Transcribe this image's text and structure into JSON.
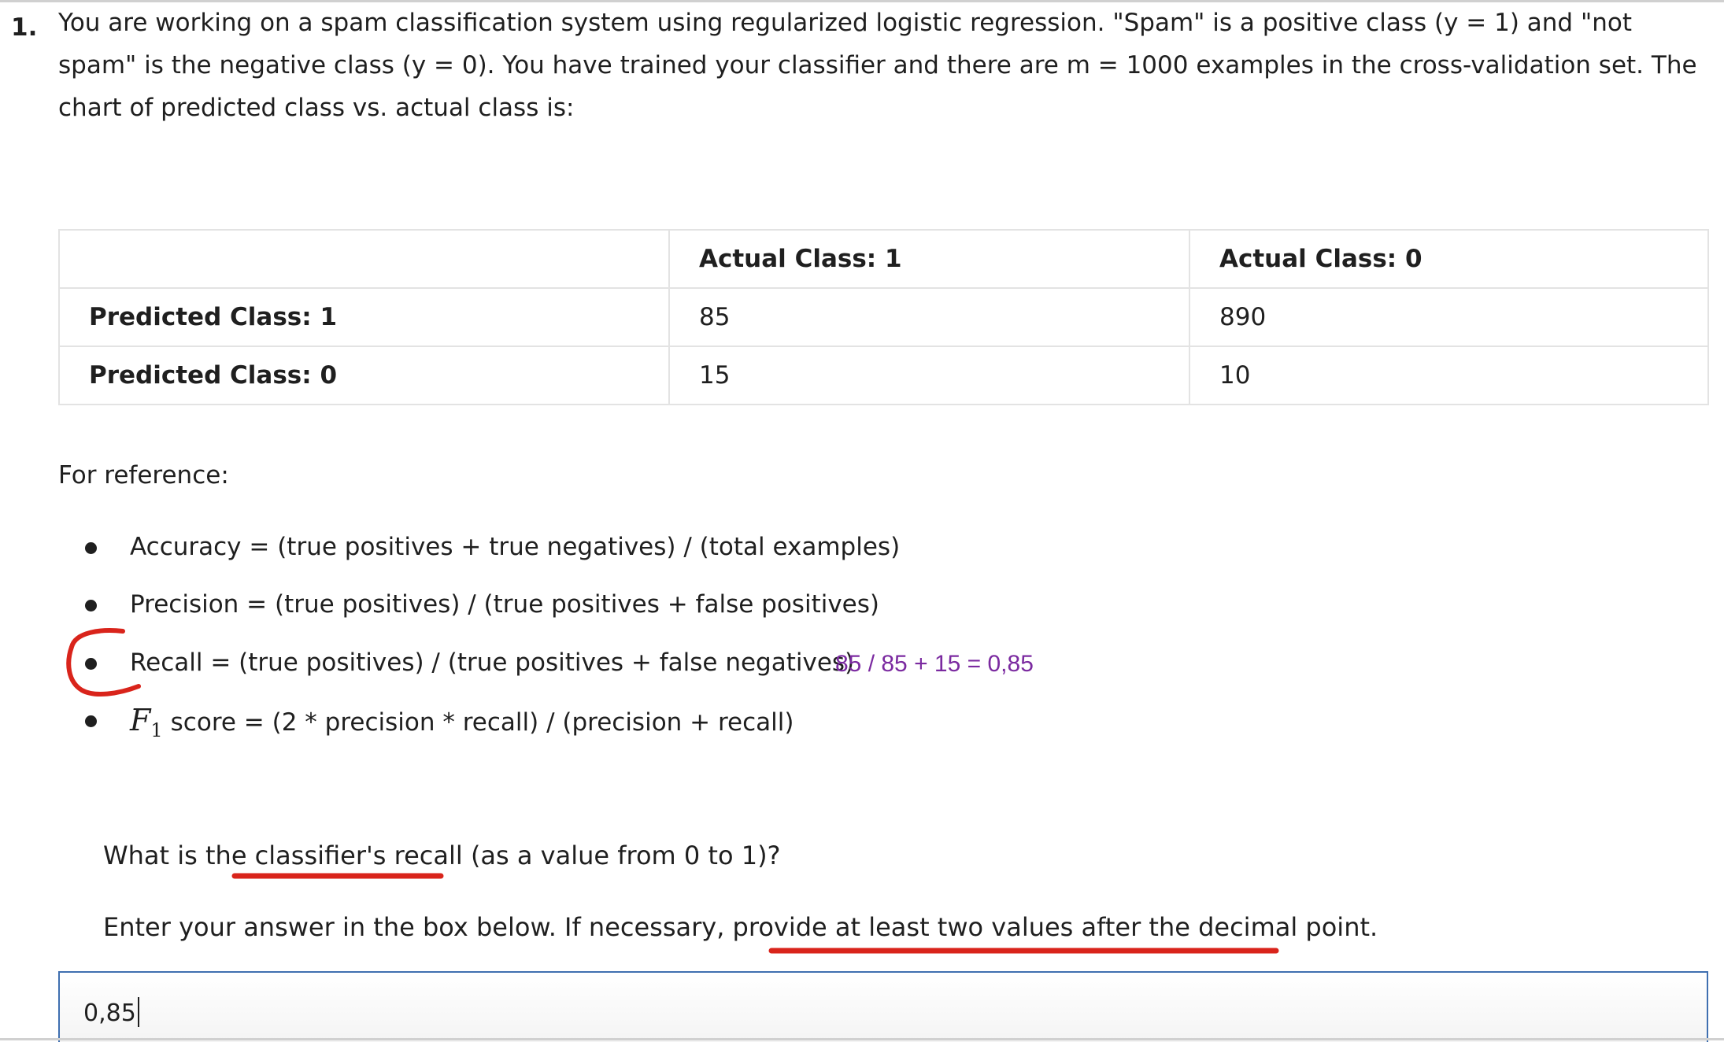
{
  "question": {
    "number": "1.",
    "text": "You are working on a spam classification system using regularized logistic regression. \"Spam\" is a positive class (y = 1) and \"not spam\" is the negative class (y = 0). You have trained your classifier and there are m = 1000 examples in the cross-validation set. The chart of predicted class vs. actual class is:"
  },
  "matrix": {
    "headers": [
      "",
      "Actual Class: 1",
      "Actual Class: 0"
    ],
    "rows": [
      {
        "label": "Predicted Class: 1",
        "values": [
          "85",
          "890"
        ]
      },
      {
        "label": "Predicted Class: 0",
        "values": [
          "15",
          "10"
        ]
      }
    ]
  },
  "reference": {
    "title": "For reference:",
    "items": [
      "Accuracy = (true positives + true negatives) / (total examples)",
      "Precision = (true positives) / (true positives + false positives)",
      "Recall = (true positives) / (true positives + false negatives)",
      {
        "symbol": "F",
        "subscript": "1",
        "text": "score = (2 * precision * recall) / (precision + recall)"
      }
    ],
    "handwritten_note": "85 / 85 + 15 = 0,85"
  },
  "prompt": {
    "question": "What is the classifier's recall (as a value from 0 to 1)?",
    "instruction": "Enter your answer in the box below. If necessary, provide at least two values after the decimal point."
  },
  "answer": {
    "value": "0,85"
  },
  "colors": {
    "annotation_red": "#d9241b",
    "note_purple": "#7b2aa0",
    "input_border": "#3f6fb0"
  }
}
